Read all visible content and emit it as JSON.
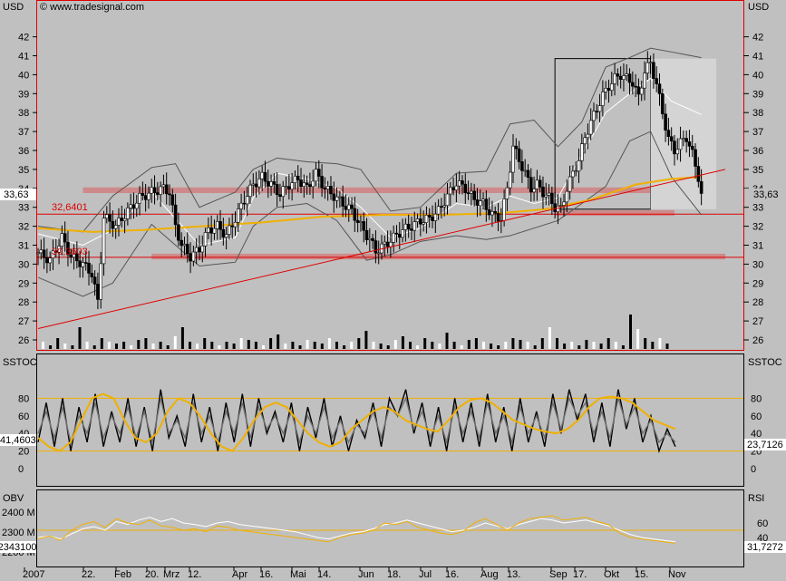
{
  "header": {
    "currency_left": "USD",
    "currency_right": "USD",
    "watermark": "© www.tradesignal.com"
  },
  "panels": {
    "stoch": {
      "label_left": "SSTOC",
      "label_right": "SSTOC",
      "value_left": "41,4603",
      "value_right": "23,7126"
    },
    "obv": {
      "label_left": "OBV",
      "label_right": "RSI",
      "value_left": "-2343100",
      "value_right": "31,7272"
    }
  },
  "markers": {
    "current_price_left": "33,63",
    "current_price_right": "33,63",
    "level_1": "32,6401",
    "level_2": "30,3603"
  },
  "colors": {
    "background": "#c0c0c0",
    "frame_red": "#e00000",
    "moving_average": "#f0b000",
    "support_zone": "#d08080",
    "band_grey": "#606060"
  },
  "chart_data": [
    {
      "type": "candlestick",
      "title": "",
      "ylabel": "USD",
      "ylim": [
        25.6,
        43.3
      ],
      "yticks": [
        26,
        27,
        28,
        29,
        30,
        31,
        32,
        33,
        34,
        35,
        36,
        37,
        38,
        39,
        40,
        41,
        42
      ],
      "x_tick_labels": [
        "2007",
        "22.",
        "Feb",
        "20.",
        "Mrz",
        "12.",
        "Apr",
        "16.",
        "Mai",
        "14.",
        "Jun",
        "18.",
        "Jul",
        "16.",
        "Aug",
        "13.",
        "Sep",
        "17.",
        "Okt",
        "15.",
        "Nov"
      ],
      "price_path": [
        [
          0,
          30.6
        ],
        [
          4,
          30.2
        ],
        [
          8,
          31.4
        ],
        [
          11,
          30.4
        ],
        [
          15,
          30.0
        ],
        [
          18,
          29.5
        ],
        [
          20,
          28.0
        ],
        [
          22,
          32.5
        ],
        [
          26,
          32.0
        ],
        [
          30,
          32.8
        ],
        [
          34,
          33.5
        ],
        [
          38,
          33.8
        ],
        [
          42,
          34.0
        ],
        [
          44,
          33.8
        ],
        [
          46,
          32.0
        ],
        [
          48,
          31.0
        ],
        [
          51,
          30.4
        ],
        [
          54,
          30.8
        ],
        [
          57,
          31.8
        ],
        [
          60,
          32.0
        ],
        [
          63,
          31.5
        ],
        [
          66,
          32.4
        ],
        [
          69,
          33.4
        ],
        [
          72,
          34.2
        ],
        [
          75,
          34.6
        ],
        [
          78,
          34.2
        ],
        [
          81,
          33.7
        ],
        [
          84,
          34.2
        ],
        [
          87,
          34.5
        ],
        [
          90,
          34.0
        ],
        [
          93,
          34.8
        ],
        [
          96,
          34.0
        ],
        [
          99,
          33.6
        ],
        [
          102,
          33.2
        ],
        [
          105,
          32.8
        ],
        [
          108,
          32.0
        ],
        [
          111,
          31.3
        ],
        [
          113,
          30.7
        ],
        [
          116,
          31.0
        ],
        [
          119,
          31.4
        ],
        [
          122,
          31.8
        ],
        [
          125,
          32.0
        ],
        [
          128,
          32.3
        ],
        [
          131,
          32.4
        ],
        [
          134,
          32.8
        ],
        [
          137,
          33.6
        ],
        [
          140,
          34.3
        ],
        [
          143,
          34.0
        ],
        [
          146,
          33.4
        ],
        [
          149,
          33.2
        ],
        [
          152,
          32.6
        ],
        [
          155,
          32.4
        ],
        [
          157,
          34.0
        ],
        [
          159,
          36.2
        ],
        [
          161,
          35.5
        ],
        [
          163,
          34.8
        ],
        [
          165,
          34.0
        ],
        [
          167,
          34.2
        ],
        [
          169,
          33.8
        ],
        [
          171,
          33.5
        ],
        [
          173,
          33.0
        ],
        [
          175,
          32.9
        ],
        [
          177,
          34.0
        ],
        [
          179,
          34.8
        ],
        [
          181,
          35.5
        ],
        [
          183,
          36.7
        ],
        [
          185,
          37.5
        ],
        [
          187,
          38.2
        ],
        [
          189,
          38.9
        ],
        [
          191,
          39.4
        ],
        [
          193,
          39.8
        ],
        [
          195,
          40.0
        ],
        [
          197,
          39.8
        ],
        [
          199,
          39.6
        ],
        [
          201,
          38.8
        ],
        [
          203,
          40.2
        ],
        [
          205,
          40.6
        ],
        [
          207,
          39.5
        ],
        [
          209,
          38.0
        ],
        [
          211,
          36.6
        ],
        [
          213,
          36.0
        ],
        [
          215,
          36.4
        ],
        [
          217,
          36.7
        ],
        [
          219,
          35.8
        ],
        [
          221,
          34.6
        ],
        [
          222,
          33.63
        ]
      ],
      "bollinger_upper": [
        [
          0,
          32.0
        ],
        [
          15,
          31.7
        ],
        [
          25,
          33.6
        ],
        [
          38,
          35.1
        ],
        [
          46,
          35.3
        ],
        [
          54,
          33.0
        ],
        [
          66,
          33.8
        ],
        [
          72,
          35.0
        ],
        [
          80,
          35.6
        ],
        [
          90,
          35.4
        ],
        [
          100,
          35.3
        ],
        [
          108,
          35.0
        ],
        [
          118,
          32.8
        ],
        [
          128,
          33.0
        ],
        [
          140,
          34.8
        ],
        [
          150,
          34.9
        ],
        [
          158,
          37.4
        ],
        [
          166,
          37.6
        ],
        [
          174,
          36.2
        ],
        [
          182,
          37.5
        ],
        [
          190,
          40.4
        ],
        [
          198,
          40.9
        ],
        [
          205,
          41.4
        ],
        [
          212,
          41.2
        ],
        [
          222,
          40.9
        ]
      ],
      "bollinger_lower": [
        [
          0,
          29.3
        ],
        [
          15,
          28.3
        ],
        [
          25,
          29.0
        ],
        [
          38,
          32.1
        ],
        [
          46,
          31.0
        ],
        [
          54,
          29.9
        ],
        [
          66,
          30.1
        ],
        [
          72,
          32.0
        ],
        [
          80,
          33.0
        ],
        [
          90,
          33.2
        ],
        [
          100,
          32.3
        ],
        [
          110,
          30.2
        ],
        [
          118,
          30.5
        ],
        [
          128,
          31.2
        ],
        [
          140,
          31.5
        ],
        [
          150,
          31.3
        ],
        [
          158,
          31.5
        ],
        [
          166,
          31.9
        ],
        [
          174,
          32.3
        ],
        [
          182,
          33.2
        ],
        [
          190,
          34.1
        ],
        [
          198,
          36.5
        ],
        [
          205,
          37.0
        ],
        [
          212,
          34.6
        ],
        [
          222,
          32.6
        ]
      ],
      "keltner_path": [
        [
          0,
          31.6
        ],
        [
          15,
          31.0
        ],
        [
          25,
          31.8
        ],
        [
          38,
          33.8
        ],
        [
          46,
          32.4
        ],
        [
          54,
          31.0
        ],
        [
          66,
          31.4
        ],
        [
          72,
          33.5
        ],
        [
          80,
          34.8
        ],
        [
          90,
          34.5
        ],
        [
          100,
          34.0
        ],
        [
          108,
          33.0
        ],
        [
          118,
          31.4
        ],
        [
          128,
          31.9
        ],
        [
          140,
          33.2
        ],
        [
          150,
          33.0
        ],
        [
          158,
          33.6
        ],
        [
          166,
          33.2
        ],
        [
          174,
          33.5
        ],
        [
          182,
          35.8
        ],
        [
          190,
          38.0
        ],
        [
          198,
          39.0
        ],
        [
          205,
          39.8
        ],
        [
          212,
          38.6
        ],
        [
          222,
          37.9
        ]
      ],
      "moving_average": [
        [
          0,
          31.9
        ],
        [
          18,
          31.7
        ],
        [
          35,
          31.8
        ],
        [
          55,
          32.0
        ],
        [
          75,
          32.2
        ],
        [
          95,
          32.5
        ],
        [
          115,
          32.6
        ],
        [
          135,
          32.6
        ],
        [
          155,
          32.7
        ],
        [
          170,
          32.9
        ],
        [
          185,
          33.4
        ],
        [
          200,
          34.2
        ],
        [
          212,
          34.5
        ],
        [
          222,
          34.6
        ]
      ],
      "trendline": [
        [
          0,
          26.6
        ],
        [
          230,
          35.0
        ]
      ],
      "horizontal_lines": [
        32.6401,
        30.3603
      ],
      "support_zones": [
        {
          "from_x": 15,
          "to_x": 225,
          "low": 33.75,
          "high": 34.05
        },
        {
          "from_x": 38,
          "to_x": 230,
          "low": 30.25,
          "high": 30.55
        },
        {
          "from_x": 173,
          "to_x": 213,
          "low": 32.55,
          "high": 32.85
        }
      ],
      "boxes": [
        {
          "from_x": 173,
          "to_x": 205,
          "low": 32.9,
          "high": 40.85,
          "style": "outline"
        },
        {
          "from_x": 205,
          "to_x": 227,
          "low": 32.9,
          "high": 40.85,
          "style": "fill"
        }
      ],
      "volume_relative": [
        0.2,
        0.1,
        0.3,
        0.15,
        0.1,
        0.6,
        0.2,
        0.1,
        0.3,
        0.2,
        0.15,
        0.2,
        0.1,
        0.25,
        0.3,
        0.15,
        0.2,
        0.1,
        0.35,
        0.6,
        0.2,
        0.15,
        0.3,
        0.2,
        0.1,
        0.2,
        0.15,
        0.3,
        0.25,
        0.2,
        0.1,
        0.3,
        0.4,
        0.15,
        0.2,
        0.1,
        0.25,
        0.2,
        0.15,
        0.3,
        0.2,
        0.1,
        0.2,
        0.3,
        0.5,
        0.2,
        0.15,
        0.1,
        0.25,
        0.35,
        0.2,
        0.1,
        0.3,
        0.2,
        0.15,
        0.45,
        0.2,
        0.1,
        0.25,
        0.3,
        0.2,
        0.15,
        0.1,
        0.2,
        0.3,
        0.25,
        0.2,
        0.1,
        0.3,
        0.6,
        0.3,
        0.15,
        0.2,
        0.1,
        0.25,
        0.2,
        0.15,
        0.3,
        0.2,
        0.1,
        0.95,
        0.55,
        0.3,
        0.2,
        0.3,
        0.15,
        0.2,
        0.35,
        0.25
      ]
    },
    {
      "type": "line",
      "title": "SSTOC",
      "ylim": [
        -5,
        105
      ],
      "yticks": [
        0,
        20,
        40,
        60,
        80
      ],
      "reference_lines": [
        80,
        20
      ],
      "series": [
        {
          "color": "#000000",
          "values": [
            30,
            75,
            25,
            80,
            20,
            70,
            30,
            85,
            25,
            65,
            30,
            80,
            25,
            70,
            20,
            90,
            35,
            60,
            25,
            85,
            30,
            70,
            20,
            75,
            30,
            85,
            25,
            80,
            40,
            65,
            30,
            75,
            20,
            70,
            35,
            80,
            25,
            60,
            20,
            55,
            35,
            75,
            25,
            80,
            60,
            90,
            40,
            75,
            25,
            70,
            20,
            80,
            30,
            75,
            25,
            85,
            30,
            70,
            20,
            80,
            30,
            65,
            25,
            85,
            40,
            90,
            55,
            85,
            30,
            75,
            25,
            90,
            45,
            80,
            30,
            60,
            20,
            45,
            25
          ]
        },
        {
          "color": "#707070",
          "values": [
            40,
            65,
            35,
            70,
            30,
            60,
            40,
            75,
            35,
            60,
            40,
            70,
            35,
            65,
            30,
            80,
            40,
            55,
            35,
            75,
            40,
            60,
            30,
            65,
            40,
            75,
            35,
            70,
            45,
            60,
            40,
            65,
            30,
            60,
            40,
            70,
            35,
            55,
            30,
            50,
            40,
            65,
            35,
            70,
            60,
            80,
            45,
            65,
            35,
            60,
            30,
            70,
            40,
            65,
            35,
            75,
            40,
            60,
            30,
            70,
            40,
            60,
            35,
            75,
            45,
            80,
            60,
            75,
            40,
            65,
            35,
            80,
            50,
            70,
            40,
            55,
            30,
            40,
            30
          ]
        },
        {
          "color": "#f0b000",
          "values": [
            35,
            25,
            20,
            30,
            55,
            80,
            85,
            80,
            55,
            35,
            30,
            40,
            65,
            80,
            75,
            60,
            40,
            25,
            20,
            35,
            55,
            70,
            75,
            70,
            55,
            40,
            30,
            25,
            30,
            45,
            55,
            65,
            70,
            65,
            55,
            50,
            45,
            42,
            55,
            70,
            78,
            80,
            75,
            65,
            55,
            50,
            45,
            42,
            40,
            45,
            55,
            70,
            80,
            82,
            80,
            75,
            65,
            55,
            50,
            45
          ]
        }
      ]
    },
    {
      "type": "line",
      "title": "OBV / RSI",
      "left_ticks": [
        "2400 M",
        "2300 M",
        "2200 M"
      ],
      "right_ticks": [
        60,
        40
      ],
      "reference_lines": [
        50
      ],
      "series": [
        {
          "name": "OBV",
          "color": "#ffffff",
          "values": [
            40,
            42,
            38,
            45,
            52,
            55,
            50,
            62,
            58,
            64,
            68,
            62,
            66,
            60,
            58,
            55,
            60,
            62,
            58,
            56,
            54,
            52,
            50,
            48,
            44,
            40,
            38,
            42,
            46,
            48,
            52,
            58,
            60,
            64,
            60,
            56,
            52,
            48,
            50,
            54,
            60,
            56,
            52,
            58,
            62,
            66,
            64,
            60,
            62,
            64,
            60,
            56,
            50,
            44,
            40,
            38,
            36,
            34
          ]
        },
        {
          "name": "RSI",
          "color": "#f0b000",
          "values": [
            38,
            42,
            36,
            50,
            58,
            62,
            54,
            66,
            60,
            58,
            64,
            56,
            54,
            50,
            52,
            48,
            56,
            54,
            50,
            48,
            46,
            44,
            42,
            40,
            38,
            36,
            34,
            40,
            44,
            46,
            50,
            60,
            58,
            62,
            54,
            50,
            46,
            44,
            48,
            60,
            66,
            58,
            50,
            60,
            66,
            68,
            70,
            64,
            66,
            68,
            62,
            58,
            46,
            40,
            38,
            36,
            34,
            32
          ]
        }
      ]
    }
  ]
}
